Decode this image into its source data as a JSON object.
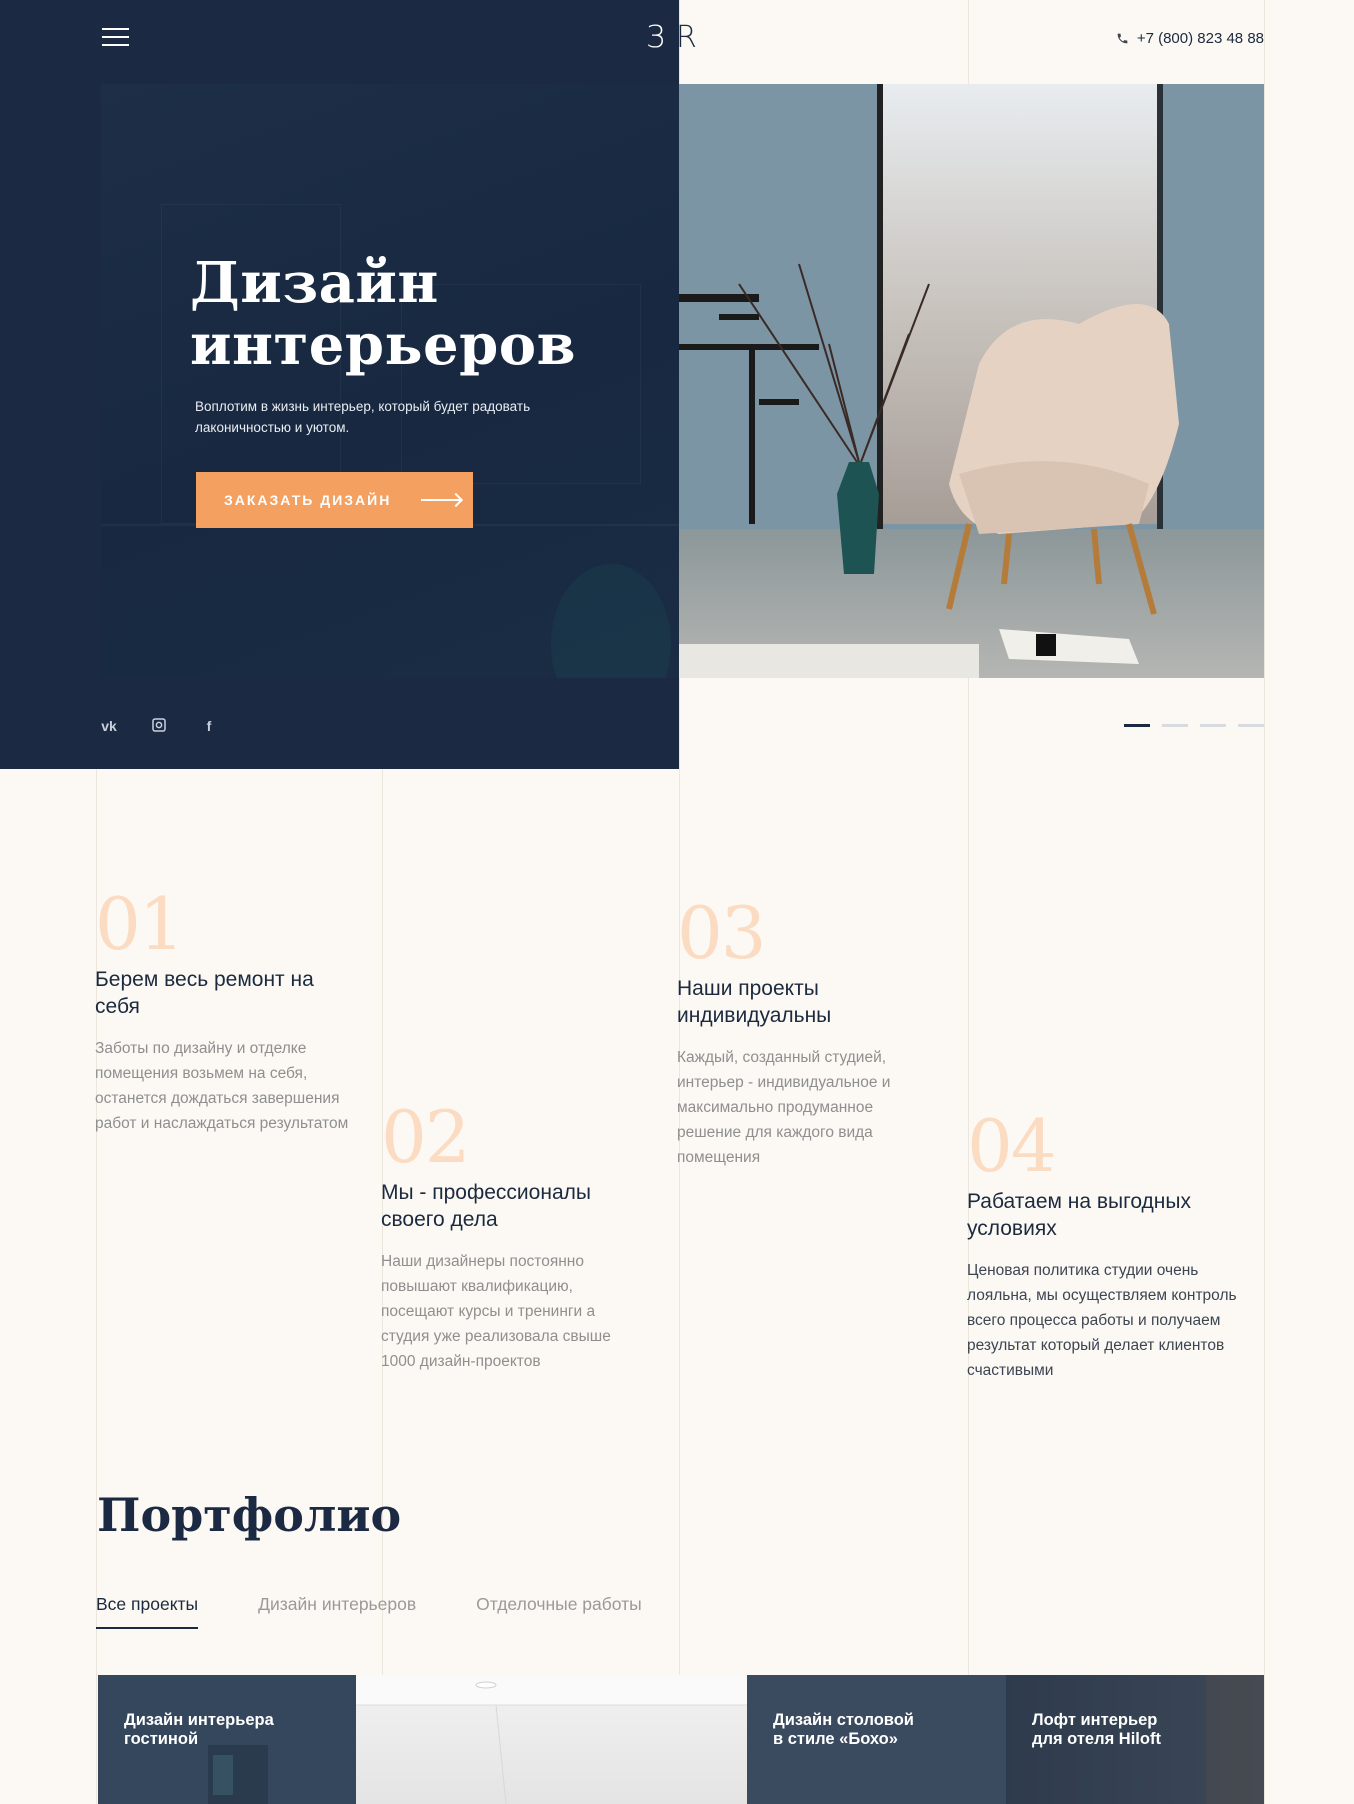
{
  "header": {
    "logo_left": "З",
    "logo_right": "R",
    "phone": "+7 (800) 823  48 88"
  },
  "hero": {
    "title_line1": "Дизайн",
    "title_line2": "интерьеров",
    "subtitle": "Воплотим в жизнь интерьер, который будет радовать лаконичностью и уютом.",
    "cta_label": "ЗАКАЗАТЬ ДИЗАЙН",
    "slider_active_index": 0,
    "slider_count": 4
  },
  "socials": [
    "vk",
    "ig",
    "f"
  ],
  "features": [
    {
      "num": "01",
      "title": "Берем весь ремонт на себя",
      "text": "Заботы по дизайну и отделке помещения возьмем на себя, останется дождаться завершения работ и наслаждаться результатом"
    },
    {
      "num": "02",
      "title": "Мы - профессионалы своего дела",
      "text": "Наши дизайнеры постоянно повышают квалификацию, посещают курсы и тренинги а студия уже реализовала свыше 1000 дизайн-проектов"
    },
    {
      "num": "03",
      "title": "Наши проекты индивидуальны",
      "text": "Каждый, созданный студией, интерьер - индивидуальное и максимально продуманное решение для каждого вида помещения"
    },
    {
      "num": "04",
      "title": "Рабатаем на выгодных условиях",
      "text": "Ценовая политика студии очень лояльна,  мы осуществляем контроль всего процесса работы и получаем результат который делает клиентов счастивыми"
    }
  ],
  "portfolio": {
    "title": "Портфолио",
    "tabs": [
      "Все проекты",
      "Дизайн интерьеров",
      "Отделочные работы"
    ],
    "cards": [
      {
        "line1": "Дизайн интерьера",
        "line2": "гостиной"
      },
      {
        "line1": "",
        "line2": ""
      },
      {
        "line1": "Дизайн столовой",
        "line2": "в стиле «Бохо»"
      },
      {
        "line1": "Лофт интерьер",
        "line2": "для отеля Hiloft"
      }
    ]
  },
  "colors": {
    "navy": "#1b2a42",
    "accent": "#f4a061",
    "number_peach": "#fbdcc2",
    "background": "#fcf9f4"
  }
}
